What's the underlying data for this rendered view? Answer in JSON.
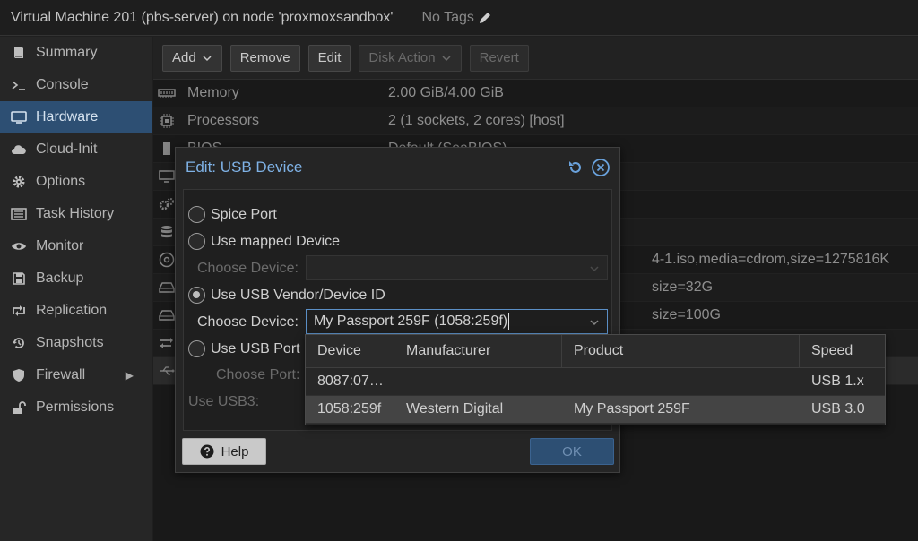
{
  "header": {
    "title": "Virtual Machine 201 (pbs-server) on node 'proxmoxsandbox'",
    "tags": "No Tags"
  },
  "sidebar": {
    "items": [
      {
        "label": "Summary",
        "icon": "book-icon"
      },
      {
        "label": "Console",
        "icon": "terminal-icon"
      },
      {
        "label": "Hardware",
        "icon": "monitor-icon",
        "active": true
      },
      {
        "label": "Cloud-Init",
        "icon": "cloud-icon"
      },
      {
        "label": "Options",
        "icon": "gear-icon"
      },
      {
        "label": "Task History",
        "icon": "list-icon"
      },
      {
        "label": "Monitor",
        "icon": "eye-icon"
      },
      {
        "label": "Backup",
        "icon": "floppy-icon"
      },
      {
        "label": "Replication",
        "icon": "retweet-icon"
      },
      {
        "label": "Snapshots",
        "icon": "history-icon"
      },
      {
        "label": "Firewall",
        "icon": "shield-icon",
        "has_arrow": true
      },
      {
        "label": "Permissions",
        "icon": "unlock-icon"
      }
    ]
  },
  "toolbar": {
    "add": "Add",
    "remove": "Remove",
    "edit": "Edit",
    "disk_action": "Disk Action",
    "revert": "Revert"
  },
  "hardware": {
    "rows": [
      {
        "name": "Memory",
        "value": "2.00 GiB/4.00 GiB",
        "icon": "memory-icon"
      },
      {
        "name": "Processors",
        "value": "2 (1 sockets, 2 cores) [host]",
        "icon": "cpu-icon"
      },
      {
        "name": "BIOS",
        "value": "Default (SeaBIOS)",
        "icon": "chip-icon"
      },
      {
        "name": "",
        "value": "",
        "icon": "display-icon"
      },
      {
        "name": "",
        "value": "",
        "icon": "cogs-icon"
      },
      {
        "name": "",
        "value": "",
        "icon": "database-icon"
      },
      {
        "name": "",
        "value": "4-1.iso,media=cdrom,size=1275816K",
        "icon": "cdrom-icon"
      },
      {
        "name": "",
        "value": "size=32G",
        "icon": "hdd-icon"
      },
      {
        "name": "",
        "value": "size=100G",
        "icon": "hdd-icon"
      },
      {
        "name": "",
        "value": "",
        "icon": "network-icon"
      },
      {
        "name": "",
        "value": "",
        "icon": "usb-icon"
      }
    ]
  },
  "dialog": {
    "title": "Edit: USB Device",
    "options": {
      "spice": "Spice Port",
      "mapped": "Use mapped Device",
      "vendor": "Use USB Vendor/Device ID",
      "port": "Use USB Port"
    },
    "choose_device_label": "Choose Device:",
    "choose_device_value": "My Passport 259F (1058:259f)",
    "choose_port_label": "Choose Port:",
    "use_usb3_label": "Use USB3:",
    "help": "Help",
    "ok": "OK"
  },
  "picker": {
    "columns": [
      "Device",
      "Manufacturer",
      "Product",
      "Speed"
    ],
    "rows": [
      {
        "device": "8087:07…",
        "manufacturer": "",
        "product": "",
        "speed": "USB 1.x"
      },
      {
        "device": "1058:259f",
        "manufacturer": "Western Digital",
        "product": "My Passport 259F",
        "speed": "USB 3.0",
        "selected": true
      }
    ]
  }
}
